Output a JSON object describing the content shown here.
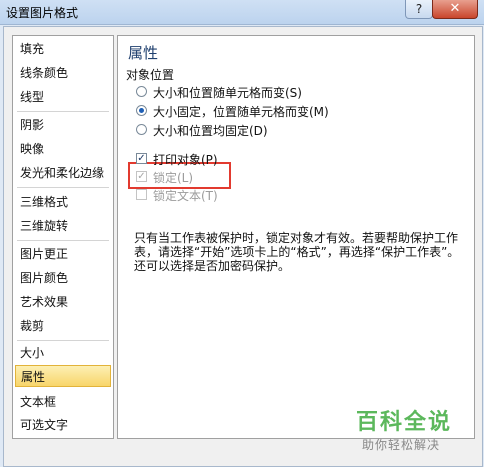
{
  "window": {
    "title": "设置图片格式",
    "help_label": "?",
    "close_label": "✕"
  },
  "nav": {
    "items": [
      {
        "label": "填充"
      },
      {
        "label": "线条颜色"
      },
      {
        "label": "线型"
      },
      {
        "label": "阴影"
      },
      {
        "label": "映像"
      },
      {
        "label": "发光和柔化边缘"
      },
      {
        "label": "三维格式"
      },
      {
        "label": "三维旋转"
      },
      {
        "label": "图片更正"
      },
      {
        "label": "图片颜色"
      },
      {
        "label": "艺术效果"
      },
      {
        "label": "裁剪"
      },
      {
        "label": "大小"
      },
      {
        "label": "属性"
      },
      {
        "label": "文本框"
      },
      {
        "label": "可选文字"
      }
    ],
    "selected": "属性"
  },
  "panel": {
    "title": "属性",
    "section": "对象位置",
    "radios": [
      {
        "label": "大小和位置随单元格而变(S)",
        "checked": false
      },
      {
        "label": "大小固定，位置随单元格而变(M)",
        "checked": true
      },
      {
        "label": "大小和位置均固定(D)",
        "checked": false
      }
    ],
    "checks": [
      {
        "label": "打印对象(P)",
        "checked": true,
        "disabled": false
      },
      {
        "label": "锁定(L)",
        "checked": true,
        "disabled": true
      },
      {
        "label": "锁定文本(T)",
        "checked": false,
        "disabled": true
      }
    ],
    "note": "只有当工作表被保护时，锁定对象才有效。若要帮助保护工作表，请选择“开始”选项卡上的“格式”，再选择“保护工作表”。还可以选择是否加密码保护。"
  },
  "watermark": {
    "main": "百科全说",
    "sub": "助你轻松解决"
  },
  "colors": {
    "highlight": "#e23a2f",
    "accent": "#1f3f6e",
    "selected_bg": "#f8d56a"
  }
}
